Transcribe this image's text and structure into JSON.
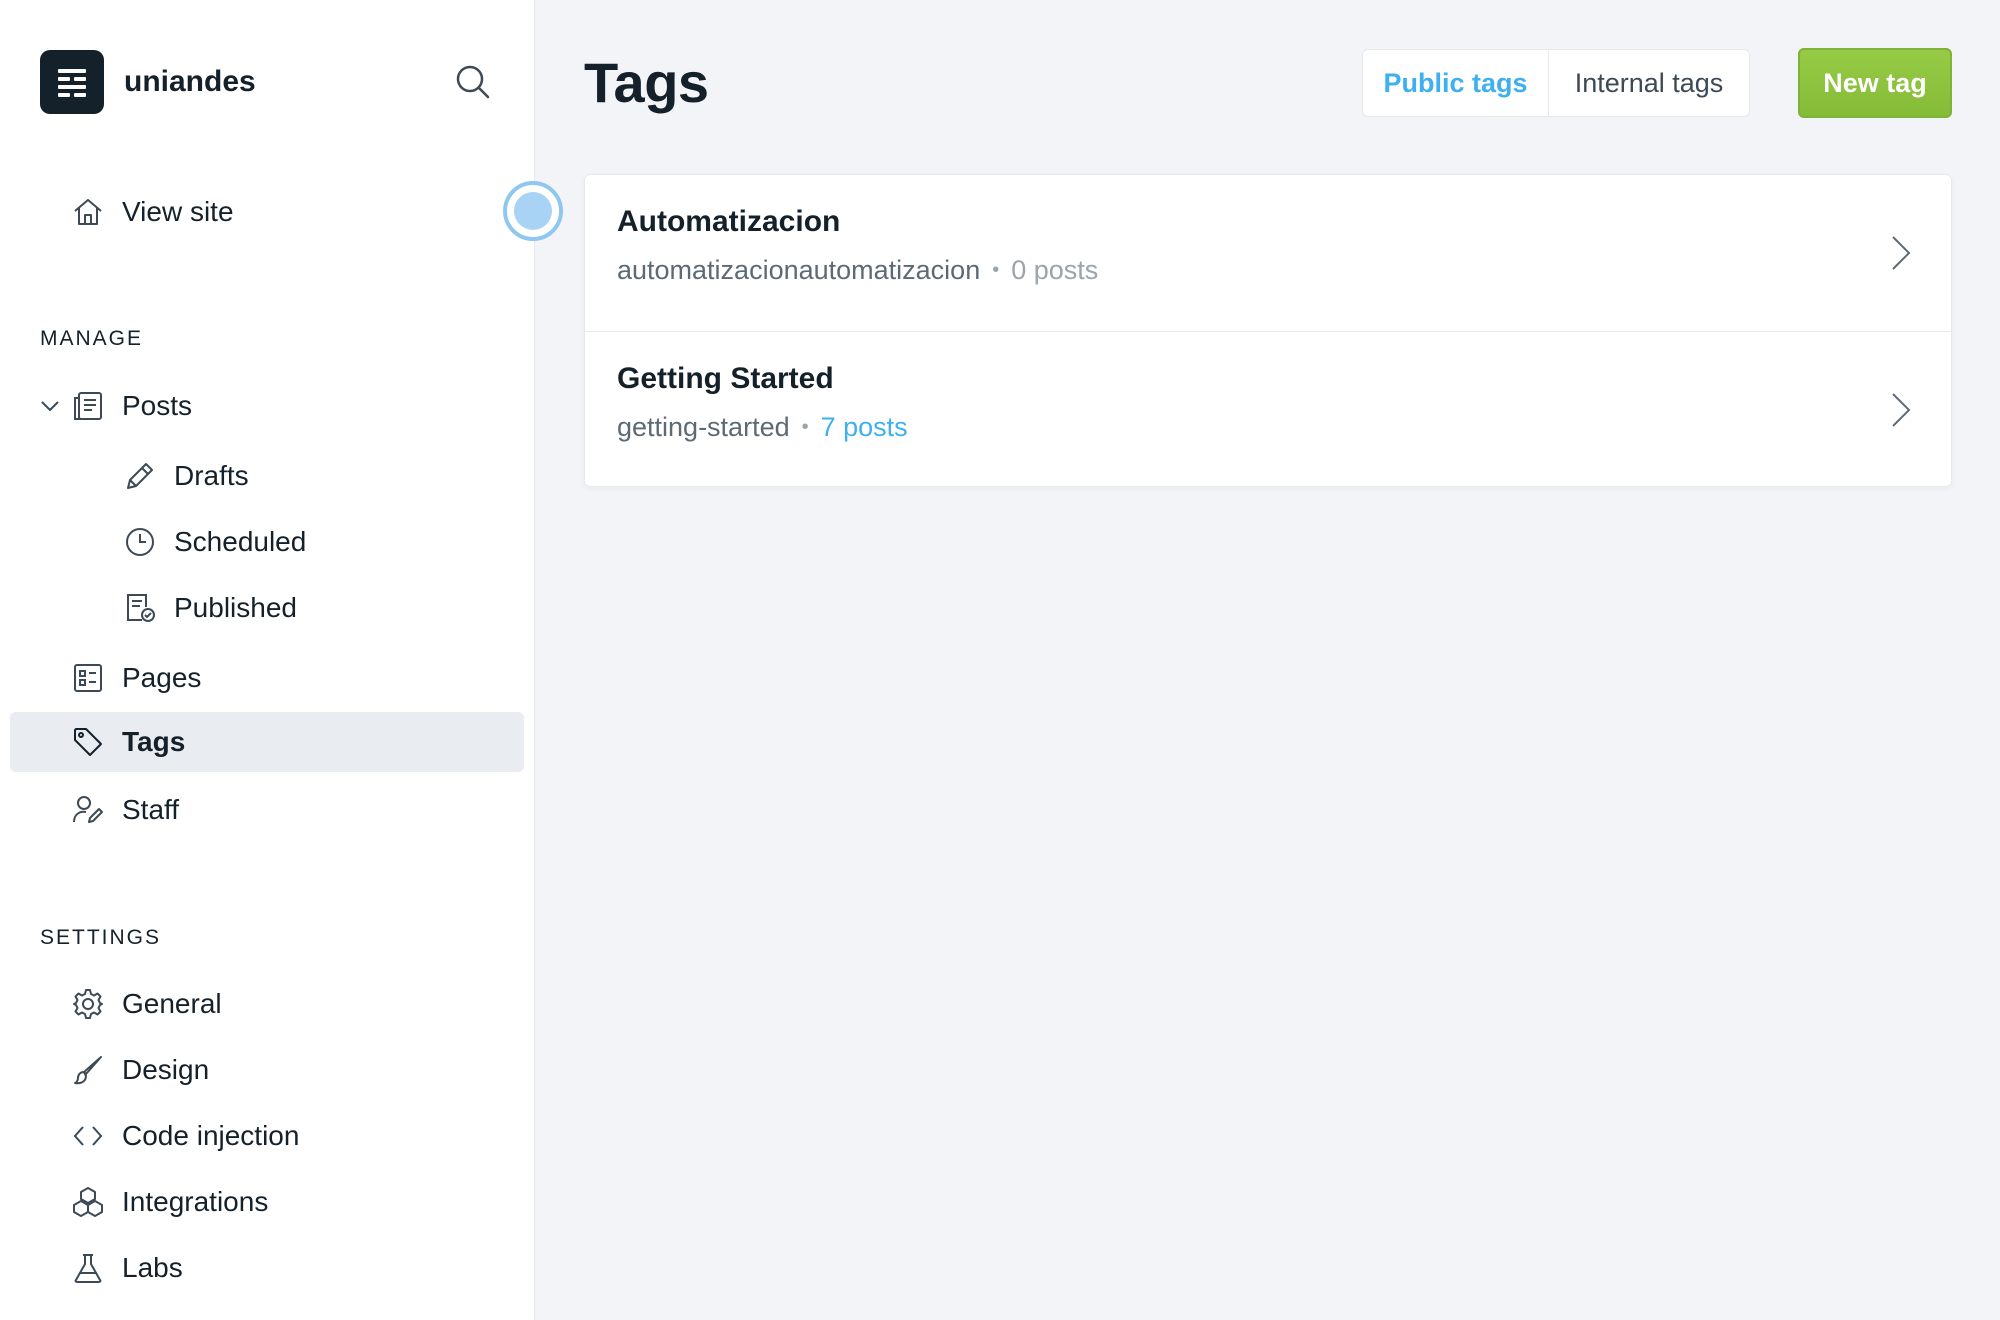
{
  "brand": {
    "name": "uniandes"
  },
  "sidebar": {
    "view_site": "View site",
    "manage_title": "MANAGE",
    "settings_title": "SETTINGS",
    "manage_items": [
      {
        "label": "Posts",
        "icon": "posts-icon"
      },
      {
        "label": "Drafts",
        "icon": "pencil-icon"
      },
      {
        "label": "Scheduled",
        "icon": "clock-icon"
      },
      {
        "label": "Published",
        "icon": "published-icon"
      },
      {
        "label": "Pages",
        "icon": "pages-icon"
      },
      {
        "label": "Tags",
        "icon": "tag-icon",
        "active": true
      },
      {
        "label": "Staff",
        "icon": "staff-icon"
      }
    ],
    "settings_items": [
      {
        "label": "General",
        "icon": "gear-icon"
      },
      {
        "label": "Design",
        "icon": "brush-icon"
      },
      {
        "label": "Code injection",
        "icon": "code-icon"
      },
      {
        "label": "Integrations",
        "icon": "integrations-icon"
      },
      {
        "label": "Labs",
        "icon": "flask-icon"
      }
    ]
  },
  "main": {
    "title": "Tags",
    "filters": {
      "public": "Public tags",
      "internal": "Internal tags",
      "active": "public"
    },
    "new_button": "New tag",
    "tags": [
      {
        "name": "Automatizacion",
        "slug": "automatizacionautomatizacion",
        "count": "0 posts"
      },
      {
        "name": "Getting Started",
        "slug": "getting-started",
        "count": "7 posts"
      }
    ]
  },
  "colors": {
    "accent": "#3eb0ef",
    "primary_button": "#8ec43f",
    "text": "#15212a",
    "active_bg": "#e9ecf0"
  }
}
